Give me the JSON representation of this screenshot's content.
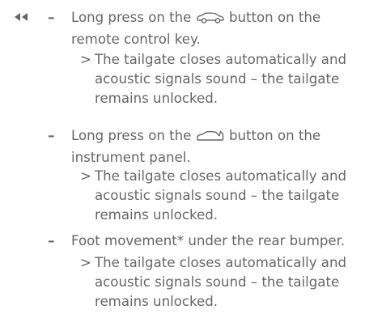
{
  "nav": {
    "back_icon": "double-left-triangle-icon"
  },
  "list": {
    "items": [
      {
        "bullet": "–",
        "step_before": "Long press on the",
        "icon": "car-key-icon",
        "step_after": "button on the remote control key.",
        "result_marker": ">",
        "result": "The tailgate closes automatically and acoustic signals sound – the tailgate remains unlocked."
      },
      {
        "bullet": "–",
        "step_before": "Long press on the",
        "icon": "tailgate-icon",
        "step_after": "button on the instrument panel.",
        "result_marker": ">",
        "result": "The tailgate closes automatically and acoustic signals sound – the tailgate remains unlocked."
      },
      {
        "bullet": "–",
        "step": "Foot movement* under the rear bumper.",
        "result_marker": ">",
        "result": "The tailgate closes automatically and acoustic signals sound – the tailgate remains unlocked."
      }
    ]
  }
}
